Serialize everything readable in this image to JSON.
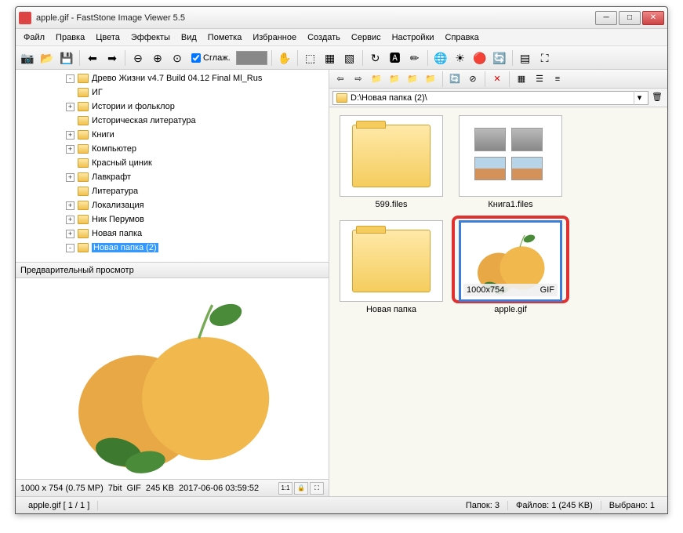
{
  "window": {
    "title": "apple.gif  -  FastStone Image Viewer 5.5"
  },
  "menu": {
    "file": "Файл",
    "edit": "Правка",
    "colors": "Цвета",
    "effects": "Эффекты",
    "view": "Вид",
    "tag": "Пометка",
    "favorites": "Избранное",
    "create": "Создать",
    "tools": "Сервис",
    "settings": "Настройки",
    "help": "Справка"
  },
  "toolbar": {
    "smooth_label": "Сглаж."
  },
  "tree": {
    "items": [
      {
        "indent": 60,
        "exp": "-",
        "label": "Древо Жизни v4.7 Build 04.12 Final Ml_Rus"
      },
      {
        "indent": 60,
        "exp": "",
        "label": "ИГ"
      },
      {
        "indent": 60,
        "exp": "+",
        "label": "Истории и фольклор"
      },
      {
        "indent": 60,
        "exp": "",
        "label": "Историческая литература"
      },
      {
        "indent": 60,
        "exp": "+",
        "label": "Книги"
      },
      {
        "indent": 60,
        "exp": "+",
        "label": "Компьютер"
      },
      {
        "indent": 60,
        "exp": "",
        "label": "Красный циник"
      },
      {
        "indent": 60,
        "exp": "+",
        "label": "Лавкрафт"
      },
      {
        "indent": 60,
        "exp": "",
        "label": "Литература"
      },
      {
        "indent": 60,
        "exp": "+",
        "label": "Локализация"
      },
      {
        "indent": 60,
        "exp": "+",
        "label": "Ник Перумов"
      },
      {
        "indent": 60,
        "exp": "+",
        "label": "Новая папка"
      },
      {
        "indent": 60,
        "exp": "-",
        "label": "Новая папка (2)",
        "selected": true
      }
    ]
  },
  "preview": {
    "header": "Предварительный просмотр",
    "dims": "1000 x 754 (0.75 MP)",
    "depth": "7bit",
    "fmt": "GIF",
    "size": "245 KB",
    "date": "2017-06-06 03:59:52",
    "btn_11": "1:1"
  },
  "path": {
    "value": "D:\\Новая папка (2)\\"
  },
  "thumbs": {
    "items": [
      {
        "type": "folder",
        "label": "599.files"
      },
      {
        "type": "book",
        "label": "Книга1.files"
      },
      {
        "type": "folder",
        "label": "Новая папка"
      },
      {
        "type": "apple",
        "label": "apple.gif",
        "selected": true,
        "highlighted": true,
        "dims": "1000x754",
        "fmt": "GIF"
      }
    ]
  },
  "status": {
    "file": "apple.gif [ 1 / 1 ]",
    "folders": "Папок: 3",
    "files": "Файлов: 1 (245 KB)",
    "selected": "Выбрано: 1"
  }
}
